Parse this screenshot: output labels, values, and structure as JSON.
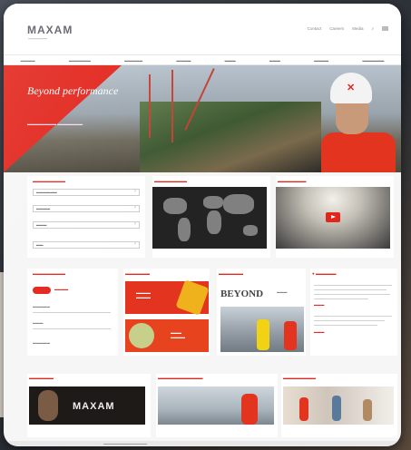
{
  "header": {
    "logo_text": "MAXAM",
    "utility_links": [
      "Contact",
      "Careers",
      "Media"
    ]
  },
  "hero": {
    "title": "Beyond performance"
  },
  "sections": {
    "featured_title": "BEYOND",
    "bottom_banner_logo": "MAXAM"
  },
  "colors": {
    "brand_red": "#e2261d",
    "text_gray": "#5b5f66",
    "page_bg": "#f6f6f6"
  },
  "icons": [
    "helmet-logo-icon",
    "play-icon",
    "chevron-down-icon",
    "search-icon",
    "flag-icon"
  ]
}
